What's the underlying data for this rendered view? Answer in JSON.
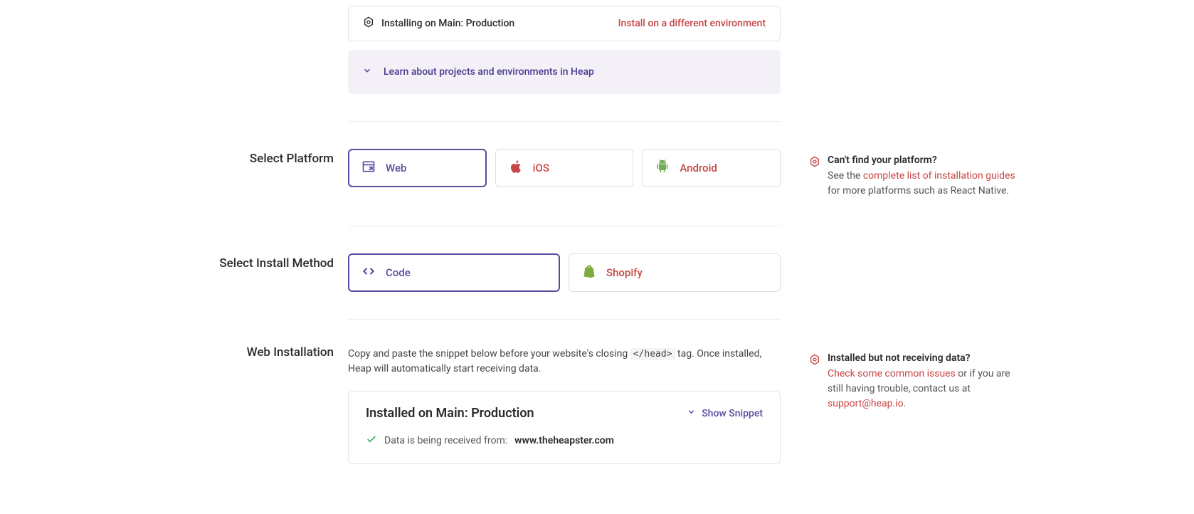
{
  "info_bar": {
    "text": "Installing on Main: Production",
    "link": "Install on a different environment"
  },
  "learn_panel": {
    "text": "Learn about projects and environments in Heap"
  },
  "platform": {
    "label": "Select Platform",
    "tiles": {
      "web": "Web",
      "ios": "iOS",
      "android": "Android"
    },
    "tip": {
      "title": "Can't find your platform?",
      "prefix": "See the ",
      "link": "complete list of installation guides",
      "suffix": " for more platforms such as React Native."
    }
  },
  "method": {
    "label": "Select Install Method",
    "tiles": {
      "code": "Code",
      "shopify": "Shopify"
    }
  },
  "installation": {
    "label": "Web Installation",
    "desc_prefix": "Copy and paste the snippet below before your website's closing ",
    "desc_code": "</head>",
    "desc_suffix": " tag. Once installed, Heap will automatically start receiving data.",
    "snippet": {
      "title": "Installed on Main: Production",
      "toggle": "Show Snippet",
      "data_label": "Data is being received from:",
      "data_url": "www.theheapster.com"
    },
    "tip": {
      "title": "Installed but not receiving data?",
      "link1": "Check some common issues",
      "mid": " or if you are still having trouble, contact us at ",
      "link2": "support@heap.io",
      "end": "."
    }
  }
}
